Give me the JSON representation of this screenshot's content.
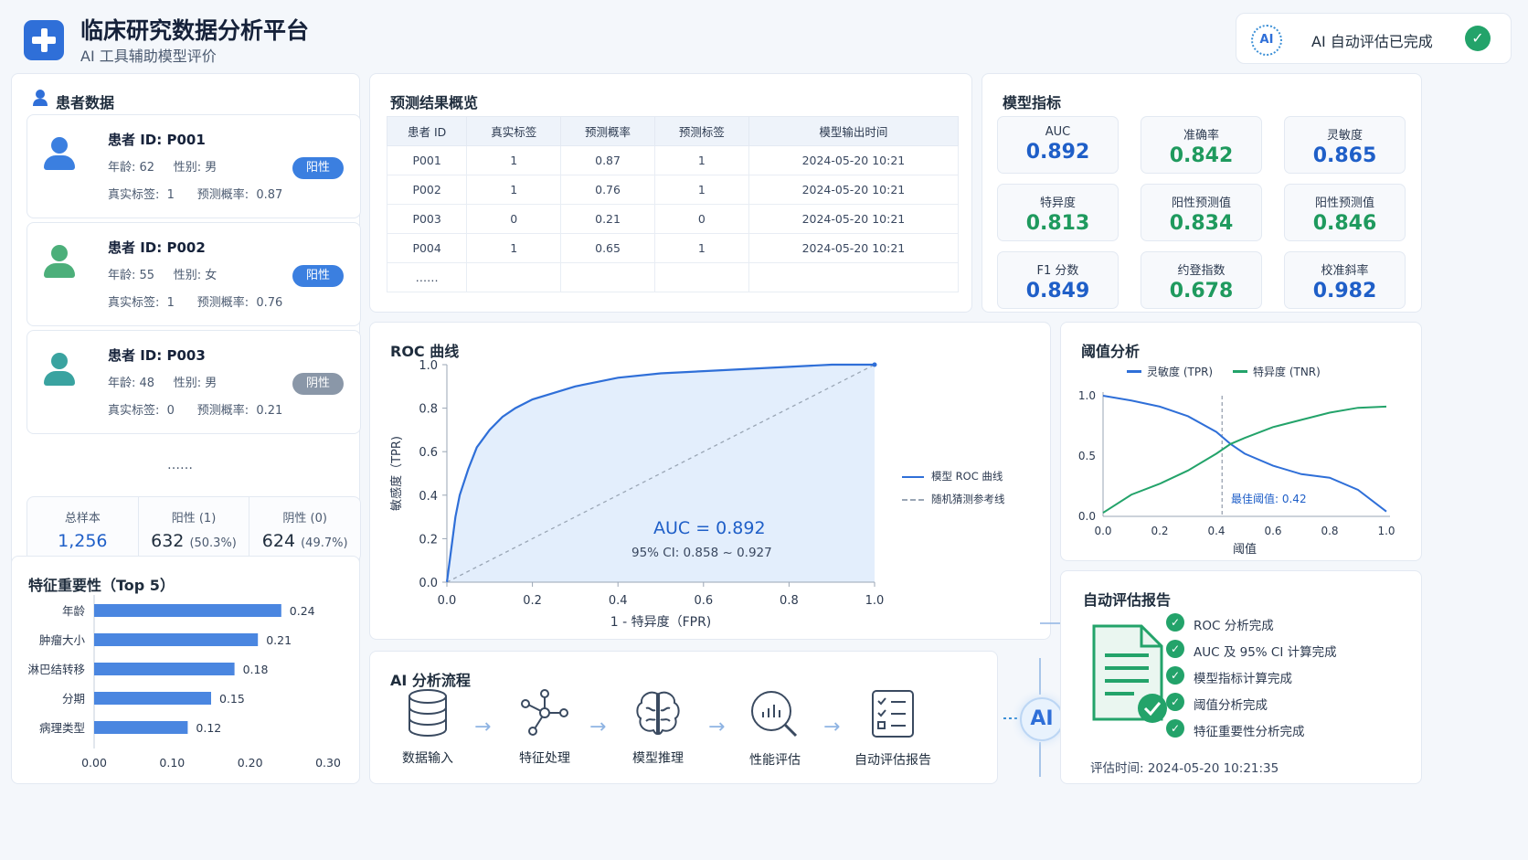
{
  "header": {
    "title": "临床研究数据分析平台",
    "subtitle": "AI 工具辅助模型评价",
    "ai_badge": "AI",
    "ai_status": "AI 自动评估已完成",
    "check_glyph": "✓"
  },
  "patients": {
    "title": "患者数据",
    "cards": [
      {
        "id": "患者 ID:  P001",
        "demo": "年龄: 62     性别: 男",
        "labels": "真实标签:  1      预测概率:  0.87",
        "badge": "阳性",
        "badge_color": "#3b7fe0",
        "avatar_color": "#3b7fe0"
      },
      {
        "id": "患者 ID:  P002",
        "demo": "年龄: 55     性别: 女",
        "labels": "真实标签:  1      预测概率:  0.76",
        "badge": "阳性",
        "badge_color": "#3b7fe0",
        "avatar_color": "#4caf7a"
      },
      {
        "id": "患者 ID:  P003",
        "demo": "年龄: 48     性别: 男",
        "labels": "真实标签:  0      预测概率:  0.21",
        "badge": "阴性",
        "badge_color": "#8a97a8",
        "avatar_color": "#3aa3a0"
      }
    ],
    "ellipsis": "……",
    "stats": [
      {
        "label": "总样本",
        "value": "1,256",
        "pct": ""
      },
      {
        "label": "阳性 (1)",
        "value": "632",
        "pct": "(50.3%)"
      },
      {
        "label": "阴性 (0)",
        "value": "624",
        "pct": "(49.7%)"
      }
    ]
  },
  "predictions": {
    "title": "预测结果概览",
    "columns": [
      "患者 ID",
      "真实标签",
      "预测概率",
      "预测标签",
      "模型输出时间"
    ],
    "rows": [
      [
        "P001",
        "1",
        "0.87",
        "1",
        "2024-05-20 10:21"
      ],
      [
        "P002",
        "1",
        "0.76",
        "1",
        "2024-05-20 10:21"
      ],
      [
        "P003",
        "0",
        "0.21",
        "0",
        "2024-05-20 10:21"
      ],
      [
        "P004",
        "1",
        "0.65",
        "1",
        "2024-05-20 10:21"
      ],
      [
        "……",
        "",
        "",
        "",
        ""
      ]
    ]
  },
  "metrics": {
    "title": "模型指标",
    "items": [
      {
        "label": "AUC",
        "value": "0.892",
        "color": "#1f5fc8"
      },
      {
        "label": "准确率",
        "value": "0.842",
        "color": "#1f9a5e"
      },
      {
        "label": "灵敏度",
        "value": "0.865",
        "color": "#1f5fc8"
      },
      {
        "label": "特异度",
        "value": "0.813",
        "color": "#1f9a5e"
      },
      {
        "label": "阳性预测值",
        "value": "0.834",
        "color": "#1f9a5e"
      },
      {
        "label": "阳性预测值",
        "value": "0.846",
        "color": "#1f9a5e"
      },
      {
        "label": "F1 分数",
        "value": "0.849",
        "color": "#1f5fc8"
      },
      {
        "label": "约登指数",
        "value": "0.678",
        "color": "#1f9a5e"
      },
      {
        "label": "校准斜率",
        "value": "0.982",
        "color": "#1f5fc8"
      }
    ]
  },
  "roc": {
    "title": "ROC 曲线",
    "auc_text": "AUC = 0.892",
    "ci_text": "95% CI: 0.858 ~ 0.927",
    "legend_model": "模型 ROC 曲线",
    "legend_random": "随机猜测参考线"
  },
  "threshold": {
    "title": "阈值分析",
    "legend_tpr": "灵敏度 (TPR)",
    "legend_tnr": "特异度 (TNR)",
    "best_text": "最佳阈值: 0.42"
  },
  "features": {
    "title": "特征重要性（Top 5）"
  },
  "flow": {
    "title": "AI 分析流程",
    "steps": [
      "数据输入",
      "特征处理",
      "模型推理",
      "性能评估",
      "自动评估报告"
    ],
    "ai_label": "AI"
  },
  "report": {
    "title": "自动评估报告",
    "items": [
      "ROC 分析完成",
      "AUC 及 95% CI 计算完成",
      "模型指标计算完成",
      "阈值分析完成",
      "特征重要性分析完成"
    ],
    "time": "评估时间: 2024-05-20 10:21:35"
  },
  "chart_data": [
    {
      "type": "line",
      "title": "ROC 曲线",
      "xlabel": "1 - 特异度（FPR)",
      "ylabel": "敏感度（TPR)",
      "xlim": [
        0,
        1
      ],
      "ylim": [
        0,
        1
      ],
      "x_ticks": [
        "0.0",
        "0.2",
        "0.4",
        "0.6",
        "0.8",
        "1.0"
      ],
      "y_ticks": [
        "0.0",
        "0.2",
        "0.4",
        "0.6",
        "0.8",
        "1.0"
      ],
      "legend": "right",
      "series": [
        {
          "name": "模型 ROC 曲线",
          "color": "#2f6fd8",
          "x": [
            0,
            0.01,
            0.02,
            0.03,
            0.05,
            0.07,
            0.1,
            0.13,
            0.16,
            0.2,
            0.25,
            0.3,
            0.35,
            0.4,
            0.5,
            0.6,
            0.7,
            0.8,
            0.9,
            1.0
          ],
          "y": [
            0,
            0.15,
            0.3,
            0.4,
            0.52,
            0.62,
            0.7,
            0.76,
            0.8,
            0.84,
            0.87,
            0.9,
            0.92,
            0.94,
            0.96,
            0.97,
            0.98,
            0.99,
            1.0,
            1.0
          ]
        },
        {
          "name": "随机猜测参考线",
          "color": "#9aa6b5",
          "x": [
            0,
            1
          ],
          "y": [
            0,
            1
          ]
        }
      ]
    },
    {
      "type": "line",
      "title": "阈值分析",
      "xlabel": "阈值",
      "xlim": [
        0,
        1
      ],
      "ylim": [
        0,
        1
      ],
      "x_ticks": [
        "0.0",
        "0.2",
        "0.4",
        "0.6",
        "0.8",
        "1.0"
      ],
      "y_ticks": [
        "0.0",
        "0.5",
        "1.0"
      ],
      "best_threshold": 0.42,
      "series": [
        {
          "name": "灵敏度 (TPR)",
          "color": "#2f6fd8",
          "x": [
            0,
            0.1,
            0.2,
            0.3,
            0.4,
            0.45,
            0.5,
            0.6,
            0.7,
            0.8,
            0.9,
            1.0
          ],
          "y": [
            1.0,
            0.96,
            0.91,
            0.83,
            0.7,
            0.6,
            0.52,
            0.42,
            0.35,
            0.32,
            0.22,
            0.04
          ]
        },
        {
          "name": "特异度 (TNR)",
          "color": "#23a36a",
          "x": [
            0,
            0.1,
            0.2,
            0.3,
            0.4,
            0.45,
            0.5,
            0.6,
            0.7,
            0.8,
            0.9,
            1.0
          ],
          "y": [
            0.03,
            0.18,
            0.27,
            0.38,
            0.52,
            0.6,
            0.65,
            0.74,
            0.8,
            0.86,
            0.9,
            0.91
          ]
        }
      ]
    },
    {
      "type": "bar",
      "title": "特征重要性（Top 5）",
      "orientation": "horizontal",
      "categories": [
        "年龄",
        "肿瘤大小",
        "淋巴结转移",
        "分期",
        "病理类型"
      ],
      "values": [
        0.24,
        0.21,
        0.18,
        0.15,
        0.12
      ],
      "xlim": [
        0,
        0.3
      ],
      "x_ticks": [
        "0.00",
        "0.10",
        "0.20",
        "0.30"
      ],
      "color": "#4a86e0"
    }
  ]
}
